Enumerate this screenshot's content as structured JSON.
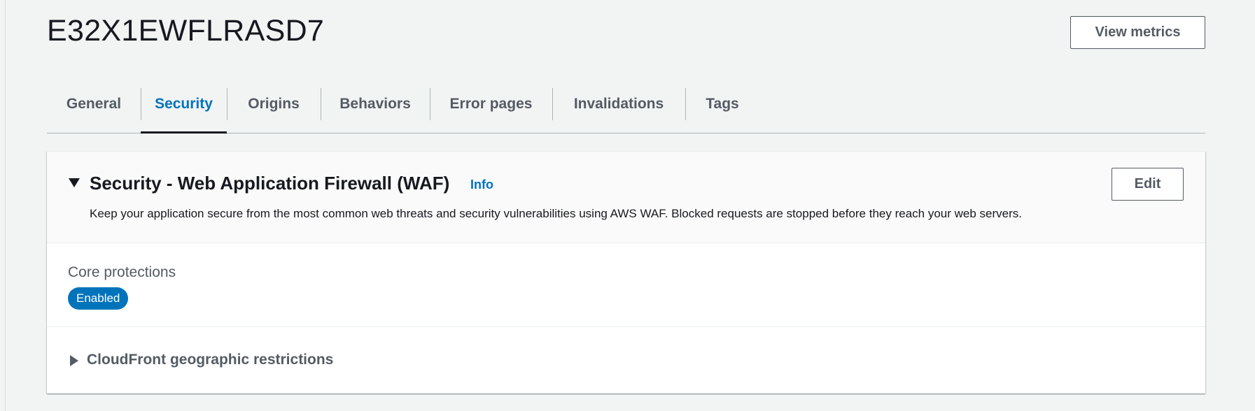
{
  "header": {
    "title": "E32X1EWFLRASD7",
    "view_metrics_label": "View metrics"
  },
  "tabs": [
    {
      "label": "General",
      "active": false
    },
    {
      "label": "Security",
      "active": true
    },
    {
      "label": "Origins",
      "active": false
    },
    {
      "label": "Behaviors",
      "active": false
    },
    {
      "label": "Error pages",
      "active": false
    },
    {
      "label": "Invalidations",
      "active": false
    },
    {
      "label": "Tags",
      "active": false
    }
  ],
  "waf_panel": {
    "title": "Security - Web Application Firewall (WAF)",
    "info_label": "Info",
    "description": "Keep your application secure from the most common web threats and security vulnerabilities using AWS WAF. Blocked requests are stopped before they reach your web servers.",
    "edit_label": "Edit",
    "core_protections_label": "Core protections",
    "core_protections_status": "Enabled",
    "geo_restrictions_label": "CloudFront geographic restrictions"
  },
  "colors": {
    "page_background": "#f2f3f3",
    "accent": "#0073bb",
    "text_primary": "#16191f",
    "text_secondary": "#545b64",
    "badge_background": "#0073bb"
  },
  "icons": {
    "panel_expanded": "caret-down-icon",
    "section_collapsed": "caret-right-icon"
  }
}
